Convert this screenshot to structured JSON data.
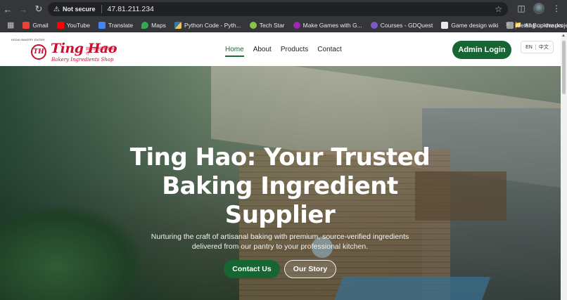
{
  "browser": {
    "security_label": "Not secure",
    "url": "47.81.211.234",
    "bookmarks": [
      {
        "label": "Gmail",
        "color": "#ea4335"
      },
      {
        "label": "YouTube",
        "color": "#ff0000"
      },
      {
        "label": "Translate",
        "color": "#4285f4"
      },
      {
        "label": "Maps",
        "color": "#34a853"
      },
      {
        "label": "Python Code - Pyth...",
        "color": "#f4c542"
      },
      {
        "label": "Tech Star",
        "color": "#8bc34a"
      },
      {
        "label": "Make Games with G...",
        "color": "#9c27b0"
      },
      {
        "label": "Courses - GDQuest",
        "color": "#7e57c2"
      },
      {
        "label": "Game design wiki",
        "color": "#e8eaed"
      },
      {
        "label": "Setting up the proje...",
        "color": "#9e9e9e"
      }
    ],
    "all_bookmarks": "All Bookmarks"
  },
  "header": {
    "logo": {
      "small_text": "KEDAI BAKERY ENTER",
      "title": "Ting Hao",
      "badge": "TH",
      "chinese": "鼎好烘焙原料貿易行",
      "subtitle": "Bakery Ingredients Shop"
    },
    "nav": [
      {
        "label": "Home",
        "active": true
      },
      {
        "label": "About",
        "active": false
      },
      {
        "label": "Products",
        "active": false
      },
      {
        "label": "Contact",
        "active": false
      }
    ],
    "admin_label": "Admin Login",
    "lang_en": "EN",
    "lang_zh": "中文"
  },
  "hero": {
    "title": "Ting Hao: Your Trusted Baking Ingredient Supplier",
    "subtitle": "Nurturing the craft of artisanal baking with premium, source-verified ingredients delivered from our pantry to your professional kitchen.",
    "primary_cta": "Contact Us",
    "secondary_cta": "Our Story"
  },
  "colors": {
    "brand_green": "#176533",
    "brand_red": "#c8102e"
  }
}
